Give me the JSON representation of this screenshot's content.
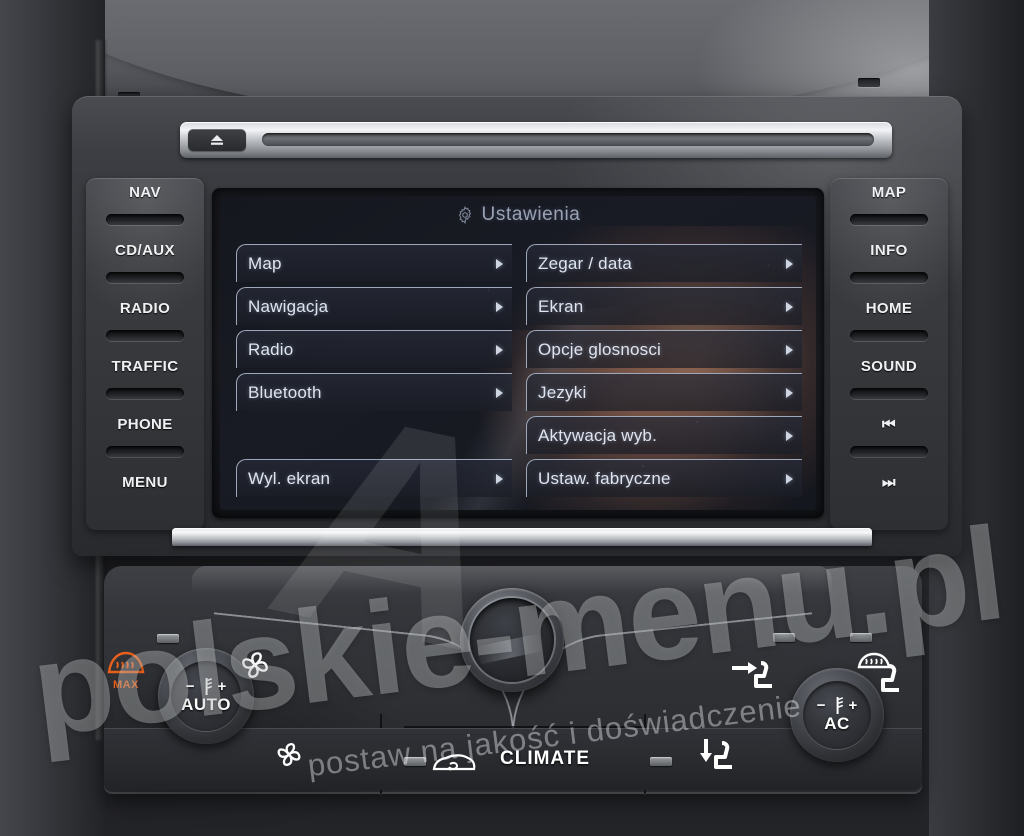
{
  "screen": {
    "title": "Ustawienia",
    "title_icon": "gear-icon",
    "menu_left": [
      {
        "label": "Map",
        "has_chevron": true
      },
      {
        "label": "Nawigacja",
        "has_chevron": true
      },
      {
        "label": "Radio",
        "has_chevron": true
      },
      {
        "label": "Bluetooth",
        "has_chevron": true
      },
      {
        "label": "",
        "has_chevron": false
      },
      {
        "label": "Wyl. ekran",
        "has_chevron": true
      }
    ],
    "menu_right": [
      {
        "label": "Zegar / data",
        "has_chevron": true
      },
      {
        "label": "Ekran",
        "has_chevron": true
      },
      {
        "label": "Opcje glosnosci",
        "has_chevron": true
      },
      {
        "label": "Jezyki",
        "has_chevron": true
      },
      {
        "label": "Aktywacja wyb.",
        "has_chevron": true
      },
      {
        "label": "Ustaw. fabryczne",
        "has_chevron": true
      }
    ]
  },
  "buttons_left": [
    {
      "label": "NAV",
      "name": "nav-button"
    },
    {
      "label": "CD/AUX",
      "name": "cd-aux-button"
    },
    {
      "label": "RADIO",
      "name": "radio-button"
    },
    {
      "label": "TRAFFIC",
      "name": "traffic-button"
    },
    {
      "label": "PHONE",
      "name": "phone-button"
    },
    {
      "label": "MENU",
      "name": "menu-button"
    }
  ],
  "buttons_right": [
    {
      "label": "MAP",
      "name": "map-button",
      "type": "text"
    },
    {
      "label": "INFO",
      "name": "info-button",
      "type": "text"
    },
    {
      "label": "HOME",
      "name": "home-button",
      "type": "text"
    },
    {
      "label": "SOUND",
      "name": "sound-button",
      "type": "text"
    },
    {
      "label": "⏮",
      "name": "previous-track-button",
      "type": "glyph"
    },
    {
      "label": "⏭",
      "name": "next-track-button",
      "type": "glyph"
    }
  ],
  "media": {
    "eject_label": "▲",
    "eject_name": "cd-eject-button"
  },
  "climate": {
    "left_knob": {
      "minus": "−",
      "plus": "+",
      "mode": "AUTO",
      "icon": "temperature-icon"
    },
    "right_knob": {
      "minus": "−",
      "plus": "+",
      "mode": "AC",
      "icon": "temperature-icon"
    },
    "climate_label": "CLIMATE",
    "max_defrost_label": "MAX",
    "icons": [
      {
        "name": "max-defrost-icon",
        "glyph": "windshield-defrost"
      },
      {
        "name": "fan-up-icon",
        "glyph": "fan"
      },
      {
        "name": "fan-down-icon",
        "glyph": "fan"
      },
      {
        "name": "airflow-face-icon",
        "glyph": "seat-arrow-forward"
      },
      {
        "name": "airflow-feet-icon",
        "glyph": "seat-arrow-down"
      },
      {
        "name": "rear-defrost-icon",
        "glyph": "rear-window-defrost"
      },
      {
        "name": "air-recirculation-icon",
        "glyph": "car-recirculate"
      }
    ],
    "accent_color": "#e8601c"
  },
  "watermark": {
    "main": "polskie-menu.pl",
    "sub": "postaw na jakość i doświadczenie",
    "mark": "A"
  },
  "colors": {
    "screen_text": "#dfe4ee",
    "screen_title": "#9aa2b4",
    "item_border": "#9fa8ba",
    "button_text": "#f0f1f2",
    "bezel": "#15161a"
  }
}
